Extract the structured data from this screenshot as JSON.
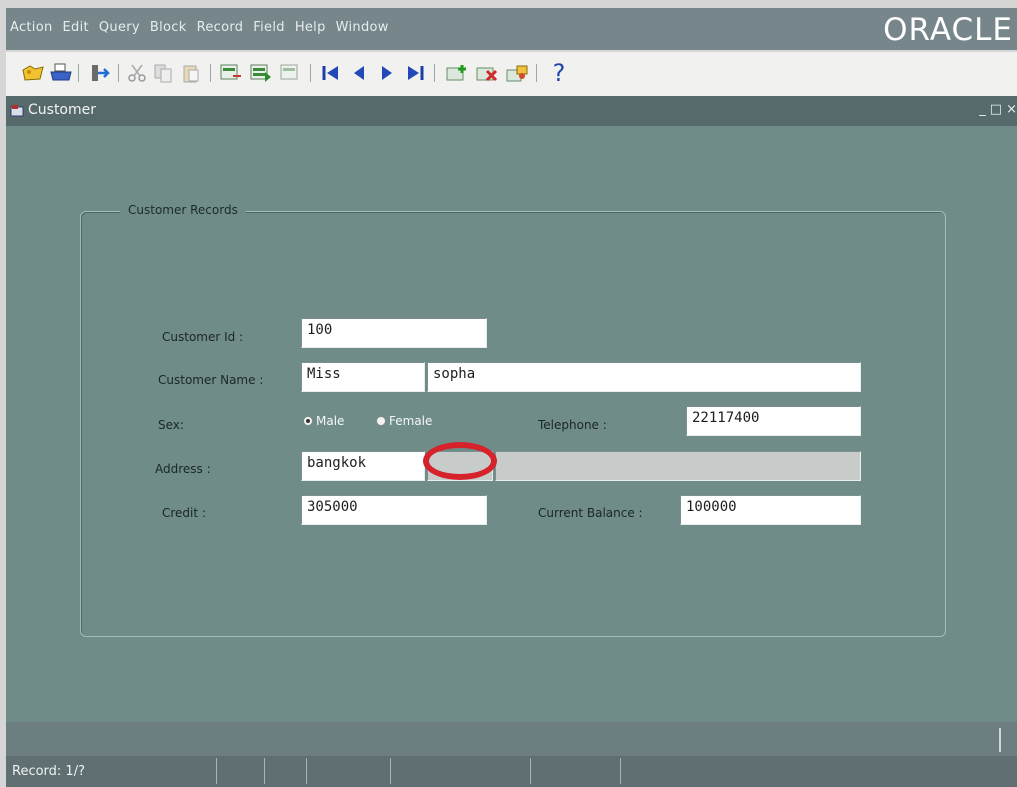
{
  "menubar": {
    "items": [
      {
        "label": "Action",
        "mnemonic": "A"
      },
      {
        "label": "Edit",
        "mnemonic": "E"
      },
      {
        "label": "Query",
        "mnemonic": "Q"
      },
      {
        "label": "Block",
        "mnemonic": "B"
      },
      {
        "label": "Record",
        "mnemonic": "R"
      },
      {
        "label": "Field",
        "mnemonic": "F"
      },
      {
        "label": "Help",
        "mnemonic": "H"
      },
      {
        "label": "Window",
        "mnemonic": "W"
      }
    ],
    "brand": "ORACLE"
  },
  "toolbar": {
    "icons": [
      "open-icon",
      "print-icon",
      "exit-icon",
      "cut-icon",
      "copy-icon",
      "paste-icon",
      "enter-query-icon",
      "execute-query-icon",
      "cancel-query-icon",
      "first-record-icon",
      "previous-record-icon",
      "next-record-icon",
      "last-record-icon",
      "insert-record-icon",
      "delete-record-icon",
      "lock-record-icon",
      "help-icon"
    ],
    "help_glyph": "?"
  },
  "window": {
    "title": "Customer",
    "controls": [
      "_",
      "□",
      "×"
    ]
  },
  "form": {
    "frame_title": "Customer Records",
    "customer_id_label": "Customer Id :",
    "customer_id": "100",
    "customer_name_label": "Customer Name :",
    "title_value": "Miss",
    "name_value": "sopha",
    "sex_label": "Sex:",
    "sex_options": [
      {
        "label": "Male",
        "selected": true
      },
      {
        "label": "Female",
        "selected": false
      }
    ],
    "telephone_label": "Telephone :",
    "telephone": "22117400",
    "address_label": "Address :",
    "address": "bangkok",
    "address_2": "",
    "address_3": "",
    "credit_label": "Credit :",
    "credit": "305000",
    "current_balance_label": "Current Balance :",
    "current_balance": "100000"
  },
  "status": {
    "record": "Record: 1/?"
  },
  "colors": {
    "menubar": "#76868a",
    "window_body": "#6f8c89",
    "highlight_ring": "#d6222a"
  }
}
